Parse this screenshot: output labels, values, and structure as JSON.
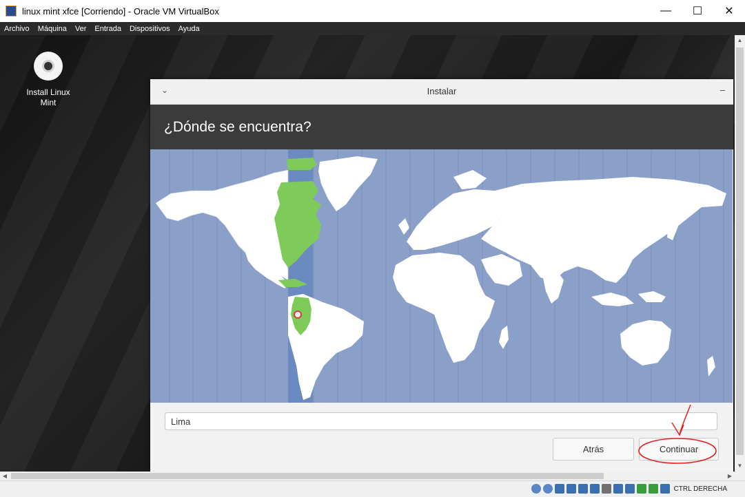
{
  "window": {
    "title": "linux mint xfce [Corriendo] - Oracle VM VirtualBox",
    "minimize": "—",
    "maximize": "☐",
    "close": "✕"
  },
  "menu": [
    "Archivo",
    "Máquina",
    "Ver",
    "Entrada",
    "Dispositivos",
    "Ayuda"
  ],
  "desktop": {
    "icon_label": "Install Linux Mint",
    "icon": "cd-disc-icon"
  },
  "installer": {
    "title": "Instalar",
    "chevron": "⌄",
    "minimize": "–",
    "heading": "¿Dónde se encuentra?",
    "location_value": "Lima",
    "back_label": "Atrás",
    "continue_label": "Continuar",
    "selected_city_marker": "Lima",
    "highlight_color": "#7ecb5a",
    "ocean_color": "#8aa0c8",
    "land_color": "#ffffff"
  },
  "statusbar": {
    "host_key": "CTRL DERECHA"
  },
  "annotation_color": "#e02020"
}
